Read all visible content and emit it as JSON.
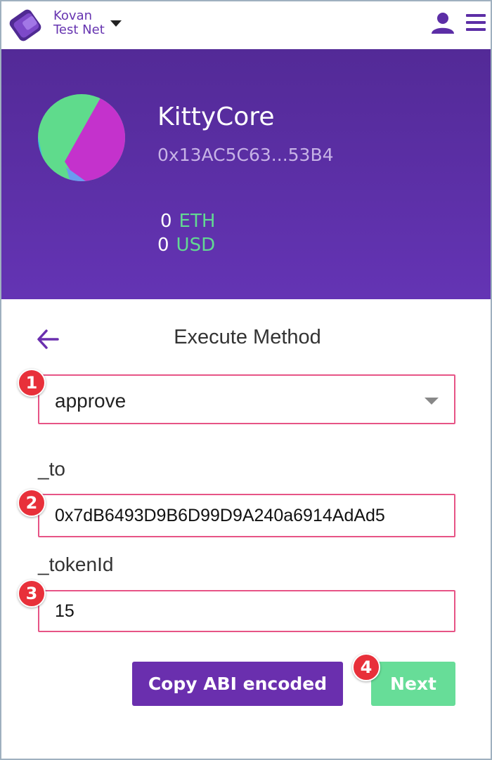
{
  "network": {
    "line1": "Kovan",
    "line2": "Test Net"
  },
  "icons": {
    "logo": "wallet-logo-icon",
    "network_dropdown": "caret-down-icon",
    "account": "user-icon",
    "menu": "hamburger-menu-icon",
    "back": "arrow-left-icon"
  },
  "contract": {
    "name": "KittyCore",
    "address": "0x13AC5C63...53B4",
    "balances": [
      {
        "amount": "0",
        "unit": "ETH"
      },
      {
        "amount": "0",
        "unit": "USD"
      }
    ]
  },
  "execute": {
    "title": "Execute Method",
    "method_selected": "approve",
    "params": [
      {
        "label": "_to",
        "value": "0x7dB6493D9B6D99D9A240a6914AdAd5"
      },
      {
        "label": "_tokenId",
        "value": "15"
      }
    ],
    "copy_button": "Copy ABI encoded",
    "next_button": "Next"
  },
  "annotations": [
    "1",
    "2",
    "3",
    "4"
  ],
  "colors": {
    "header_top": "#532a97",
    "header_bottom": "#6434b4",
    "accent_purple": "#6a2fae",
    "green": "#67dd98",
    "highlight_border": "#e75486",
    "badge_red": "#e8303a"
  }
}
